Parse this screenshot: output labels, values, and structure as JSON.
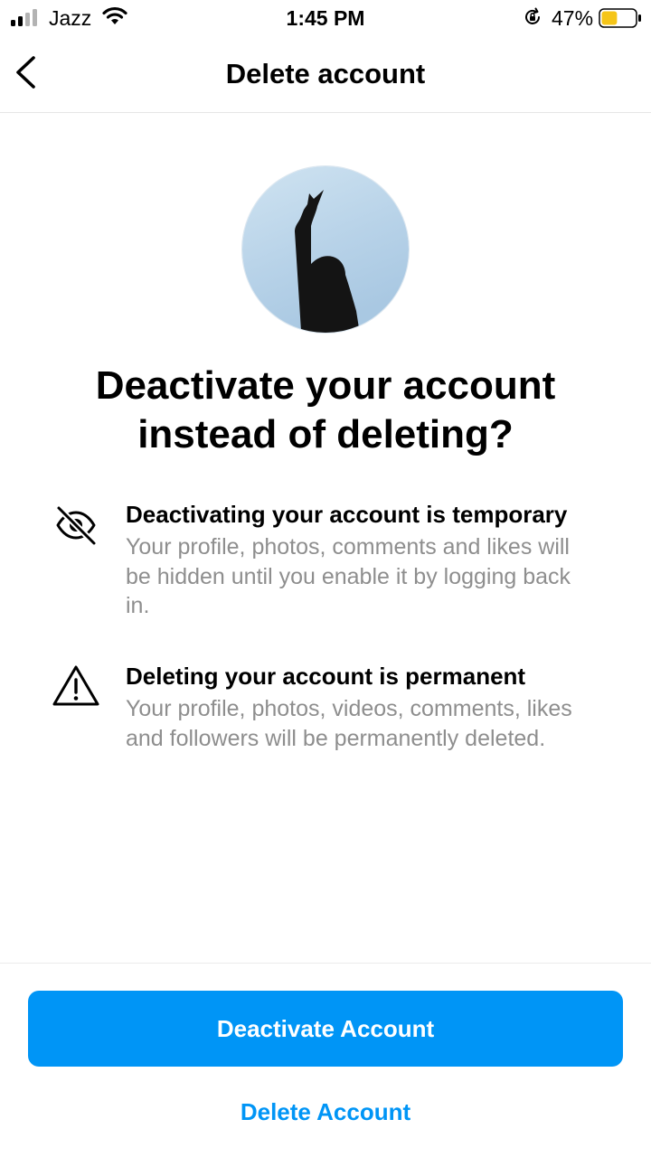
{
  "status_bar": {
    "carrier": "Jazz",
    "time": "1:45 PM",
    "battery_percent": "47%",
    "battery_level": 0.47,
    "battery_color": "#f5c518",
    "icons": [
      "signal-icon",
      "wifi-icon",
      "orientation-lock-icon",
      "battery-icon"
    ]
  },
  "header": {
    "back_icon": "chevron-left-icon",
    "title": "Delete account"
  },
  "avatar": {
    "description_icon": "profile-photo"
  },
  "headline": "Deactivate your account instead of deleting?",
  "info_items": [
    {
      "icon": "eye-off-icon",
      "title": "Deactivating your account is temporary",
      "body": "Your profile, photos, comments and likes will be hidden until you enable it by logging back in."
    },
    {
      "icon": "warning-icon",
      "title": "Deleting your account is permanent",
      "body": "Your profile, photos, videos, comments, likes and followers will be permanently deleted."
    }
  ],
  "actions": {
    "primary_label": "Deactivate Account",
    "secondary_label": "Delete Account",
    "accent_color": "#0095f6"
  }
}
